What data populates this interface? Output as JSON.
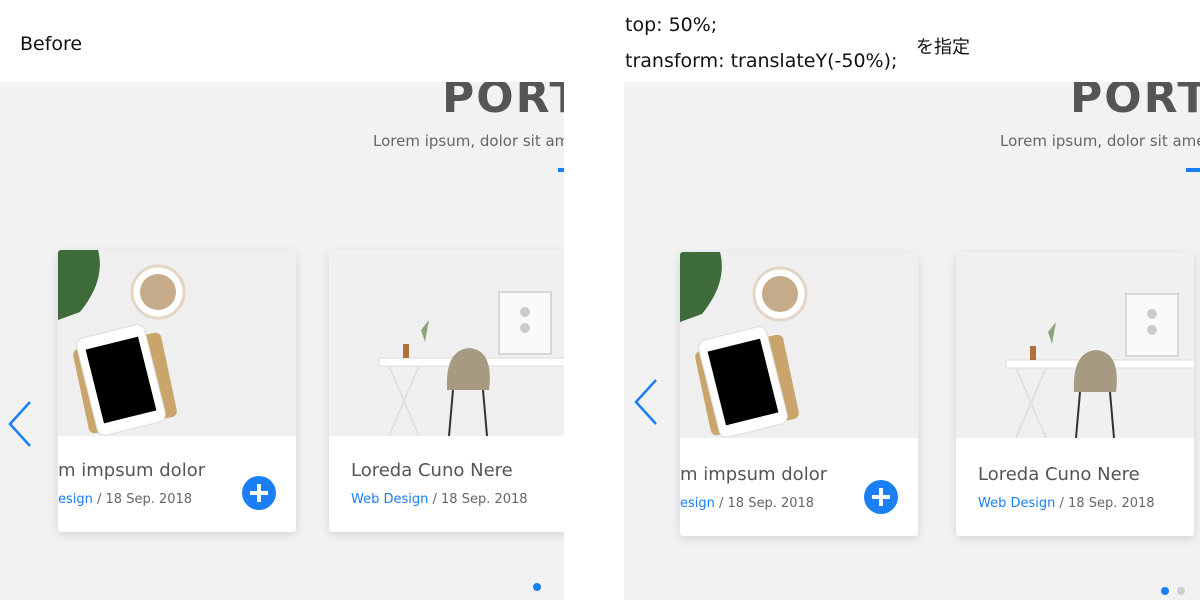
{
  "labels": {
    "before": "Before",
    "code_line1": "top: 50%;",
    "code_line2": "transform: translateY(-50%);",
    "note": "を指定"
  },
  "section": {
    "heading": "PORT",
    "subtitle": "Lorem ipsum, dolor sit ame"
  },
  "cards": [
    {
      "title": "m impsum dolor",
      "category": "esign",
      "separator": " / ",
      "date": "18 Sep. 2018"
    },
    {
      "title": "Loreda Cuno Nere",
      "category": "Web Design",
      "separator": " / ",
      "date": "18 Sep. 2018"
    }
  ],
  "right_cards": [
    {
      "title": "m impsum dolor",
      "category": "esign",
      "separator": " / ",
      "date": "18 Sep. 2018"
    },
    {
      "title": "Loreda Cuno Nere",
      "category": "Web Design",
      "separator": " / ",
      "date": "18 Sep. 2018"
    }
  ],
  "colors": {
    "accent": "#1a7ef5",
    "panel": "#f2f2f3"
  },
  "icons": {
    "prev": "chevron-left-icon",
    "more": "plus-circle-icon"
  }
}
